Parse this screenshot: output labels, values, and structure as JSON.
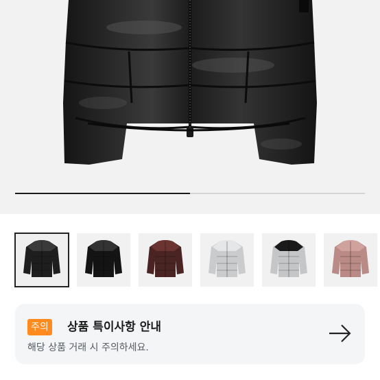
{
  "gallery": {
    "progress": 0.5,
    "thumbnails": [
      {
        "name": "black glossy puffer",
        "color": "#1e1e1e",
        "accent": "#3a3a3a",
        "selected": true
      },
      {
        "name": "black cropped puffer",
        "color": "#141414",
        "accent": "#333333",
        "selected": false
      },
      {
        "name": "burgundy puffer",
        "color": "#4a2422",
        "accent": "#6b3431",
        "selected": false
      },
      {
        "name": "silver puffer",
        "color": "#c9cbcd",
        "accent": "#e4e6e8",
        "selected": false
      },
      {
        "name": "silver black puffer",
        "color": "#c4c6c8",
        "accent": "#1a1a1a",
        "selected": false
      },
      {
        "name": "rose pink puffer",
        "color": "#b98a86",
        "accent": "#cfa29e",
        "selected": false
      }
    ]
  },
  "notice": {
    "badge": "주의",
    "title": "상품 특이사항 안내",
    "description": "해당 상품 거래 시 주의하세요.",
    "arrow_icon": "arrow-right-icon",
    "badge_color": "#ff8a1e"
  }
}
